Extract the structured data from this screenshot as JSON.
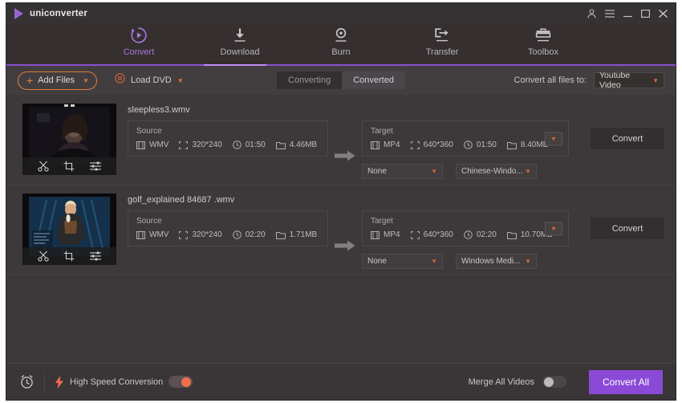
{
  "window": {
    "brand": "uniconverter",
    "controls": [
      {
        "name": "account-icon",
        "glyph": "user"
      },
      {
        "name": "menu-icon",
        "glyph": "hamburger"
      },
      {
        "name": "minimize-icon",
        "glyph": "minimize"
      },
      {
        "name": "maximize-icon",
        "glyph": "maximize"
      },
      {
        "name": "close-icon",
        "glyph": "close"
      }
    ]
  },
  "nav": {
    "items": [
      {
        "label": "Convert",
        "icon": "convert-icon",
        "active": true
      },
      {
        "label": "Download",
        "icon": "download-icon",
        "active": false
      },
      {
        "label": "Burn",
        "icon": "burn-icon",
        "active": false
      },
      {
        "label": "Transfer",
        "icon": "transfer-icon",
        "active": false
      },
      {
        "label": "Toolbox",
        "icon": "toolbox-icon",
        "active": false
      }
    ]
  },
  "toolbar": {
    "add_files_label": "Add Files",
    "load_dvd_label": "Load DVD",
    "tab_converting": "Converting",
    "tab_converted": "Converted",
    "convert_all_to_label": "Convert all files to:",
    "convert_all_to_value": "Youtube Video"
  },
  "files": [
    {
      "name": "sleepless3.wmv",
      "source_caption": "Source",
      "source": {
        "format": "WMV",
        "resolution": "320*240",
        "duration": "01:50",
        "size": "4.46MB"
      },
      "target_caption": "Target",
      "target": {
        "format": "MP4",
        "resolution": "640*360",
        "duration": "01:50",
        "size": "8.40MB"
      },
      "subtitle_dropdown": "None",
      "audio_dropdown": "Chinese-Windo...",
      "convert_label": "Convert",
      "thumb_tools": [
        "trim-icon",
        "crop-icon",
        "effect-icon"
      ]
    },
    {
      "name": "golf_explained 84687 .wmv",
      "source_caption": "Source",
      "source": {
        "format": "WMV",
        "resolution": "320*240",
        "duration": "02:20",
        "size": "1.71MB"
      },
      "target_caption": "Target",
      "target": {
        "format": "MP4",
        "resolution": "640*360",
        "duration": "02:20",
        "size": "10.70MB"
      },
      "subtitle_dropdown": "None",
      "audio_dropdown": "Windows Medi...",
      "convert_label": "Convert",
      "thumb_tools": [
        "trim-icon",
        "crop-icon",
        "effect-icon"
      ]
    }
  ],
  "bottom": {
    "high_speed_label": "High Speed Conversion",
    "high_speed_on": true,
    "merge_label": "Merge All Videos",
    "merge_on": false,
    "convert_all_label": "Convert All"
  },
  "colors": {
    "accent_purple": "#8b4ad6",
    "accent_orange": "#e07b3c",
    "toggle_on": "#ef6f4a",
    "window_bg": "#3a3739",
    "panel_bg": "#3d393b"
  }
}
